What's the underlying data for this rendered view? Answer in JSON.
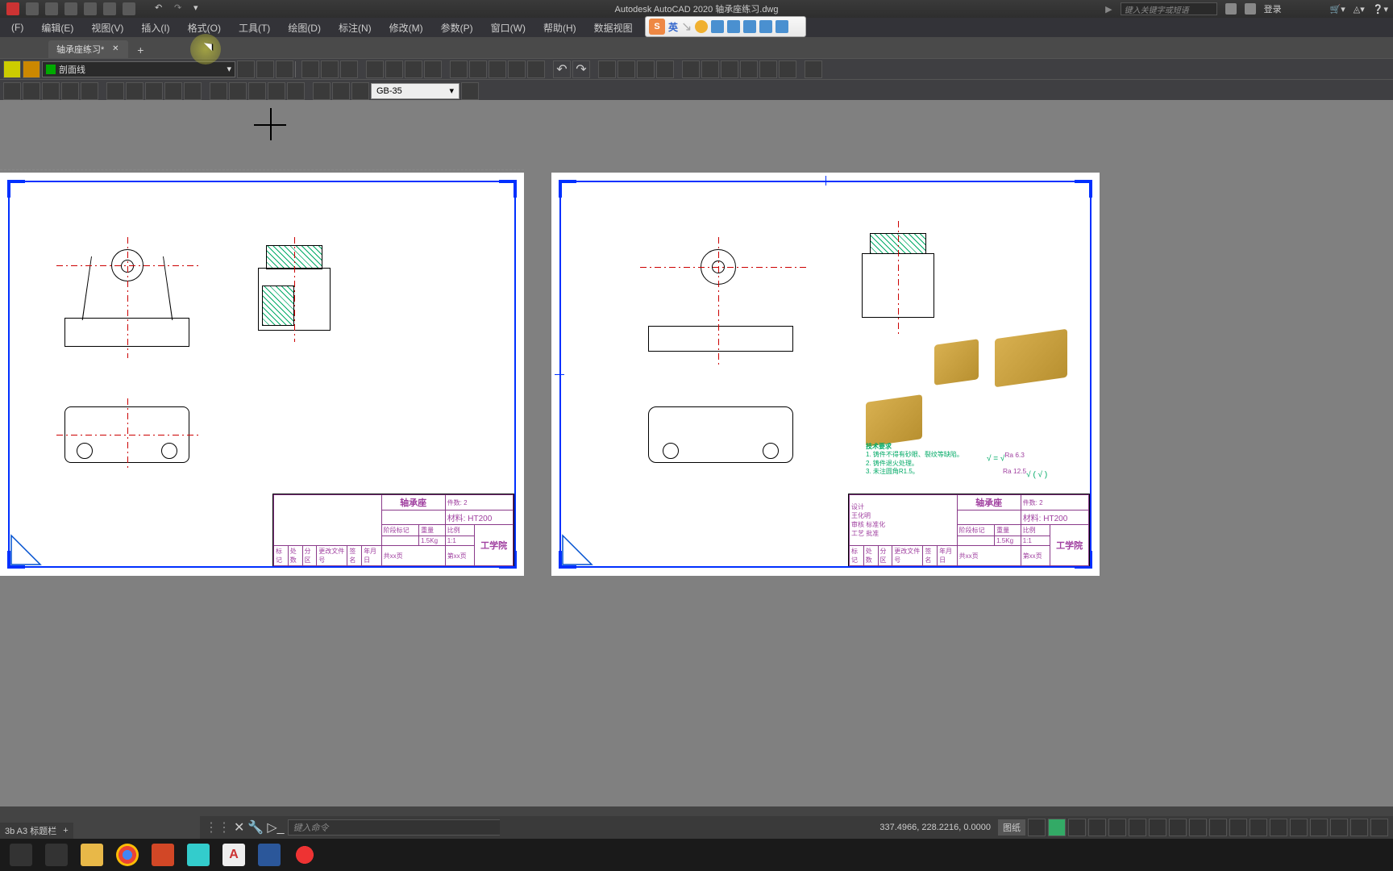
{
  "app": {
    "title": "Autodesk AutoCAD 2020   轴承座练习.dwg"
  },
  "searchHint": "键入关键字或短语",
  "login": "登录",
  "menus": [
    "(F)",
    "编辑(E)",
    "视图(V)",
    "插入(I)",
    "格式(O)",
    "工具(T)",
    "绘图(D)",
    "标注(N)",
    "修改(M)",
    "参数(P)",
    "窗口(W)",
    "帮助(H)",
    "数据视图"
  ],
  "docTab": "轴承座练习*",
  "layer": {
    "name": "剖面线"
  },
  "dimStyle": "GB-35",
  "commandHint": "键入命令",
  "layoutTab": "3b A3 标题栏",
  "status": {
    "coords": "337.4966, 228.2216, 0.0000",
    "mode": "图纸"
  },
  "ime": {
    "logo": "S",
    "lang": "英"
  },
  "titleBlock": {
    "partName": "轴承座",
    "count": "件数: 2",
    "material": "材料: HT200",
    "school": "工学院",
    "weight": "1.5Kg",
    "ratio": "1:1",
    "drawing1": "共xx页",
    "drawing2": "第xx页",
    "hdr1": "标记",
    "hdr2": "处数",
    "hdr3": "分区",
    "hdr4": "更改文件号",
    "hdr5": "签名",
    "hdr6": "年月日",
    "row1": "设计",
    "row2": "审核",
    "row3": "工艺",
    "row4": "批准",
    "col1": "阶段标记",
    "col2": "重量",
    "col3": "比例",
    "designer": "王化明",
    "check": "标准化"
  },
  "techNotes": {
    "title": "技术要求",
    "l1": "1. 铸件不得有砂眼、裂纹等缺陷。",
    "l2": "2. 铸件退火处理。",
    "l3": "3. 未注圆角R1.5。"
  }
}
